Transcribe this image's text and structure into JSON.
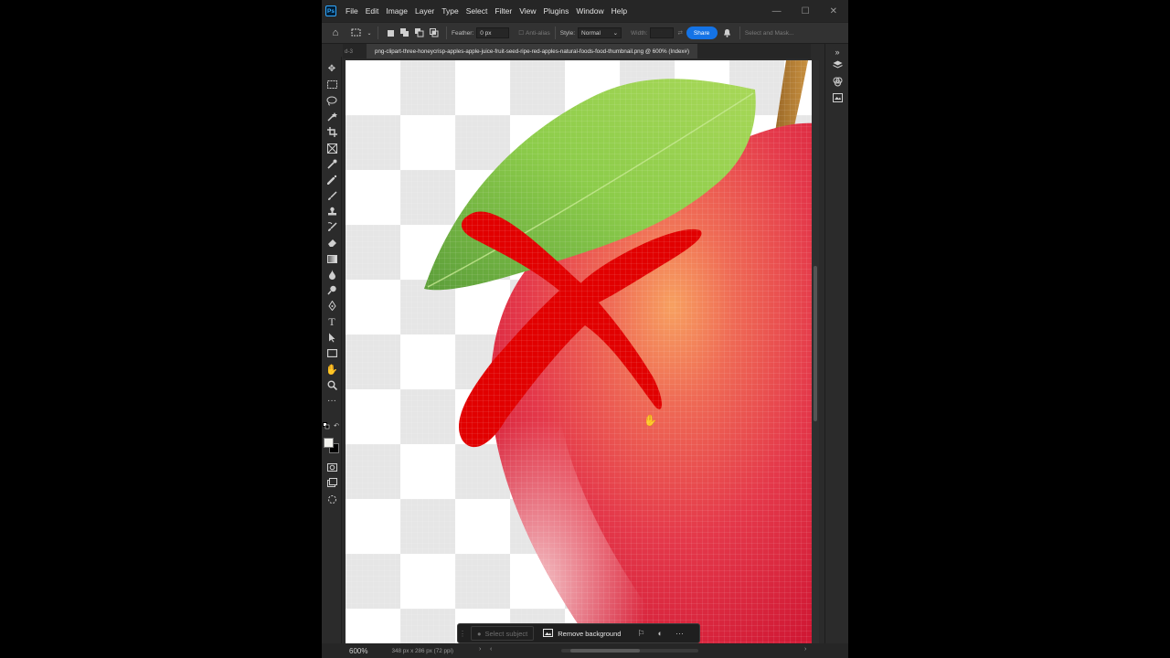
{
  "app": {
    "logo": "Ps",
    "menus": [
      "File",
      "Edit",
      "Image",
      "Layer",
      "Type",
      "Select",
      "Filter",
      "View",
      "Plugins",
      "Window",
      "Help"
    ],
    "window_controls": [
      "minimize-icon",
      "maximize-icon",
      "close-icon"
    ]
  },
  "options_bar": {
    "feather_label": "Feather:",
    "feather_value": "0 px",
    "anti_alias_label": "Anti-alias",
    "style_label": "Style:",
    "style_value": "Normal",
    "width_label": "Width:",
    "share_label": "Share",
    "select_and_mask_label": "Select and Mask..."
  },
  "tabs": {
    "previous_fragment": "d-3",
    "active_title": "png-clipart-three-honeycrisp-apples-apple-juice-fruit-seed-ripe-red-apples-natural-foods-food-thumbnail.png @ 600% (Index#)"
  },
  "tools": [
    "move-tool-icon",
    "rectangular-marquee-icon",
    "lasso-icon",
    "object-selection-icon",
    "crop-icon",
    "frame-icon",
    "eyedropper-icon",
    "spot-healing-icon",
    "brush-icon",
    "clone-stamp-icon",
    "history-brush-icon",
    "eraser-icon",
    "gradient-icon",
    "blur-icon",
    "dodge-icon",
    "pen-icon",
    "type-icon",
    "path-selection-icon",
    "rectangle-icon",
    "hand-icon",
    "zoom-icon",
    "more-tools-icon"
  ],
  "colors": {
    "foreground": "#f2f2ee",
    "background": "#000000",
    "accent": "#1473e6",
    "x_mark": "#e10000"
  },
  "status": {
    "zoom": "600%",
    "document_size": "348 px x 286 px (72 ppi)"
  },
  "contextual_task_bar": {
    "select_subject_label": "Select subject",
    "remove_background_label": "Remove background"
  }
}
